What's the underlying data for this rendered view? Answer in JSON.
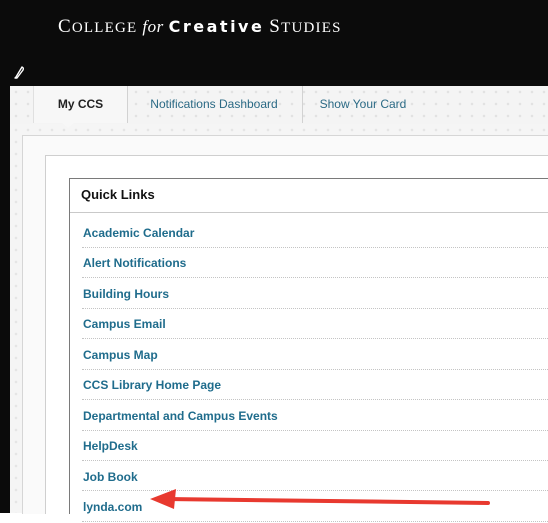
{
  "header": {
    "logo": {
      "c": "C",
      "ollege": "OLLEGE",
      "for": "for",
      "creative": "Creative",
      "s": "S",
      "tudies": "TUDIES"
    }
  },
  "tabs": [
    {
      "label": "My CCS",
      "active": true
    },
    {
      "label": "Notifications Dashboard",
      "active": false
    },
    {
      "label": "Show Your Card",
      "active": false
    }
  ],
  "quick_links": {
    "title": "Quick Links",
    "links": [
      "Academic Calendar",
      "Alert Notifications",
      "Building Hours",
      "Campus Email",
      "Campus Map",
      "CCS Library Home Page",
      "Departmental and Campus Events",
      "HelpDesk",
      "Job Book",
      "lynda.com"
    ]
  },
  "annotation": {
    "color": "#e8392f",
    "points_to": "lynda.com"
  },
  "colors": {
    "header_bg": "#0b0b0b",
    "link": "#1f6c8c",
    "tab_link": "#2b6a85"
  },
  "icons": {
    "edit": "pencil-icon"
  }
}
